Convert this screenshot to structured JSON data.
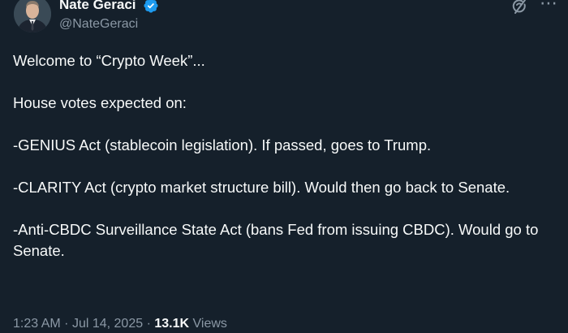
{
  "author": {
    "display_name": "Nate Geraci",
    "handle": "@NateGeraci",
    "verified": true,
    "verified_color": "#1d9bf0"
  },
  "tweet": {
    "paragraphs": [
      "Welcome to “Crypto Week”...",
      "House votes expected on:",
      "-GENIUS Act (stablecoin legislation). If passed, goes to Trump.",
      "-CLARITY Act (crypto market structure bill). Would then go back to Senate.",
      "-Anti-CBDC Surveillance State Act (bans Fed from issuing CBDC). Would go to Senate."
    ]
  },
  "meta": {
    "time": "1:23 AM",
    "separator": "·",
    "date": "Jul 14, 2025",
    "views_count": "13.1K",
    "views_label": "Views"
  },
  "icons": {
    "header_action": "grok-icon",
    "more": "more-icon"
  },
  "colors": {
    "background": "#15202b",
    "primary_text": "#f7f9f9",
    "secondary_text": "#8b98a5"
  }
}
